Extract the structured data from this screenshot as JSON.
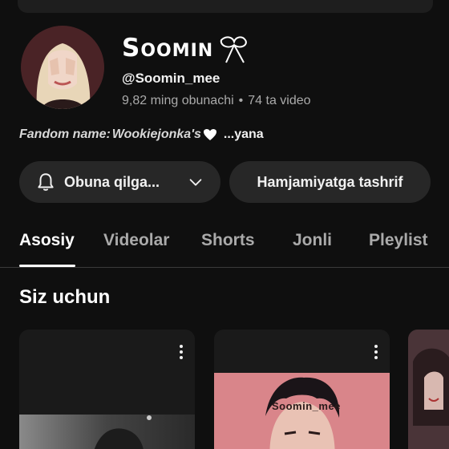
{
  "channel": {
    "name": "Soomin",
    "handle": "@Soomin_mee",
    "subscribers": "9,82 ming obunachi",
    "separator": "•",
    "videos": "74 ta video"
  },
  "description": {
    "fandom_label": "Fandom name:",
    "fandom_value": "Wookiejonka's",
    "more_label": "...yana"
  },
  "actions": {
    "subscribe_label": "Obuna qilga...",
    "community_label": "Hamjamiyatga tashrif"
  },
  "tabs": [
    {
      "label": "Asosiy",
      "active": true
    },
    {
      "label": "Videolar",
      "active": false
    },
    {
      "label": "Shorts",
      "active": false
    },
    {
      "label": "Jonli",
      "active": false
    },
    {
      "label": "Pleylist",
      "active": false
    }
  ],
  "section": {
    "title": "Siz uchun"
  },
  "cards": [
    {
      "overlay_text": ""
    },
    {
      "overlay_text": "Soomin_mee"
    },
    {
      "overlay_text": ""
    }
  ],
  "colors": {
    "background": "#0f0f0f",
    "button": "#272727",
    "muted_text": "#aaaaaa"
  }
}
